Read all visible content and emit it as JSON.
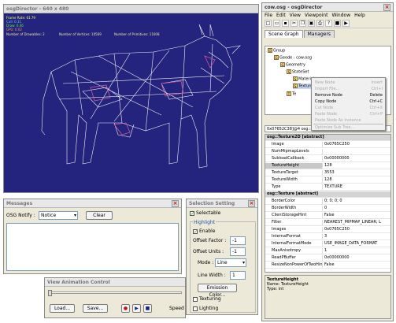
{
  "viewer": {
    "title": "osgDirector - 640 x 480",
    "stats": {
      "frame_rate": "Frame Rate: 61.79",
      "cull": "Cull: 0.11",
      "draw": "Draw: 0.46",
      "gpu": "GPU: 0.02",
      "drawables": "Number of Drawables: 2",
      "vertices": "Number of Vertices: 10569",
      "primitives": "Number of Primitives: 11608"
    }
  },
  "messages": {
    "title": "Messages",
    "notify_label": "OSG Notify :",
    "notify_value": "Notice",
    "clear_label": "Clear"
  },
  "selection": {
    "title": "Selection Setting",
    "selectable_label": "Selectable",
    "highlight_label": "Highlight",
    "enable_label": "Enable",
    "offset_factor_label": "Offset Factor :",
    "offset_factor_value": "-1",
    "offset_units_label": "Offset Units :",
    "offset_units_value": "-1",
    "mode_label": "Mode :",
    "mode_value": "Line",
    "line_width_label": "Line Width :",
    "line_width_value": "1",
    "emission_label": "Emission Color...",
    "texturing_label": "Texturing",
    "lighting_label": "Lighting"
  },
  "animation": {
    "title": "View Animation Control",
    "load_label": "Load...",
    "save_label": "Save...",
    "speed_label": "Speed"
  },
  "director": {
    "title": "cow.osg - osgDirector",
    "menu": [
      "File",
      "Edit",
      "View",
      "Viewpoint",
      "Window",
      "Help"
    ],
    "tabs": [
      "Scene Graph",
      "Managers"
    ],
    "tree": [
      {
        "icon": "G",
        "label": "Group"
      },
      {
        "icon": "G",
        "label": "Geode : cow.osg"
      },
      {
        "icon": "G",
        "label": "Geometry"
      },
      {
        "icon": "S",
        "label": "StateSet"
      },
      {
        "icon": "S",
        "label": "Material"
      },
      {
        "icon": "S",
        "label": "Texture2D"
      },
      {
        "icon": "T",
        "label": "Te"
      }
    ],
    "context_menu": [
      {
        "label": "New Node",
        "shortcut": "Insert",
        "enabled": false
      },
      {
        "label": "Import File...",
        "shortcut": "Ctrl+I",
        "enabled": false
      },
      {
        "label": "Remove Node",
        "shortcut": "Delete",
        "enabled": true
      },
      {
        "label": "Copy Node",
        "shortcut": "Ctrl+C",
        "enabled": true
      },
      {
        "label": "Cut Node",
        "shortcut": "Ctrl+X",
        "enabled": false
      },
      {
        "label": "Paste Node",
        "shortcut": "Ctrl+P",
        "enabled": false
      },
      {
        "label": "Paste Node As Instance",
        "shortcut": "",
        "enabled": false
      },
      {
        "label": "Optimize Sub Tree...",
        "shortcut": "",
        "enabled": false
      }
    ],
    "address": "0x07652C38]@4 osg::",
    "properties": [
      {
        "section": true,
        "key": "osg::Texture2D [abstract]"
      },
      {
        "key": "Image",
        "value": "0x0765C250"
      },
      {
        "key": "NumMipmapLevels",
        "value": ""
      },
      {
        "key": "SubloadCallback",
        "value": "0x00000000"
      },
      {
        "key": "TextureHeight",
        "value": "128",
        "selected": true
      },
      {
        "key": "TextureTarget",
        "value": "3553"
      },
      {
        "key": "TextureWidth",
        "value": "128"
      },
      {
        "key": "Type",
        "value": "TEXTURE"
      },
      {
        "section": true,
        "key": "osg::Texture [abstract]"
      },
      {
        "key": "BorderColor",
        "value": "0; 0; 0; 0"
      },
      {
        "key": "BorderWidth",
        "value": "0"
      },
      {
        "key": "ClientStorageHint",
        "value": "False"
      },
      {
        "key": "Filter",
        "value": "NEAREST_MIPMAP_LINEAR; L"
      },
      {
        "key": "Images",
        "value": "0x0765C250"
      },
      {
        "key": "InternalFormat",
        "value": "3"
      },
      {
        "key": "InternalFormatMode",
        "value": "USE_IMAGE_DATA_FORMAT"
      },
      {
        "key": "MaxAnisotropy",
        "value": "1"
      },
      {
        "key": "ReadPBuffer",
        "value": "0x00000000"
      },
      {
        "key": "ResizeNonPowerOfTwoHint",
        "value": "False"
      }
    ],
    "description": {
      "title": "TextureHeight",
      "name": "Name: TextureHeight",
      "type": "Type: int"
    }
  },
  "colors": {
    "viewport_bg": "#24237d",
    "wireframe": "#f2f2f2",
    "highlight": "#e25aa0"
  }
}
